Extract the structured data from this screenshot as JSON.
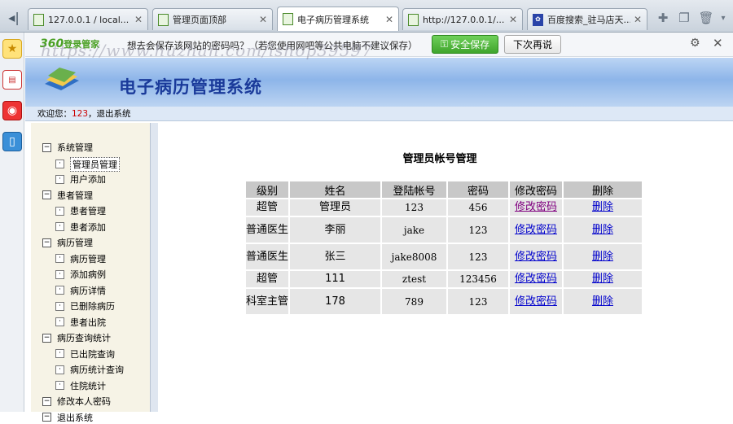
{
  "browser": {
    "tabs": [
      {
        "title": "127.0.0.1 / local...",
        "active": false
      },
      {
        "title": "管理页面顶部",
        "active": false
      },
      {
        "title": "电子病历管理系统",
        "active": true
      },
      {
        "title": "http://127.0.0.1/...",
        "active": false
      },
      {
        "title": "百度搜索_驻马店天...",
        "active": false
      }
    ],
    "tab_close_glyph": "✕",
    "toolbar_icons": [
      "plus-icon",
      "restore-icon",
      "trash-icon",
      "dropdown-icon"
    ]
  },
  "password_bar": {
    "brand": "360",
    "brand_sub": "登录管家",
    "message": "想去会保存该网站的密码吗？（若您使用网吧等公共电脑不建议保存）",
    "save_label": "安全保存",
    "later_label": "下次再说"
  },
  "watermark": "https://www.huzhan.com/ishop39597",
  "app": {
    "title": "电子病历管理系统",
    "welcome_prefix": "欢迎您：",
    "user": "123",
    "logout_link": "，退出系统"
  },
  "tree": {
    "groups": [
      {
        "label": "系统管理",
        "children": [
          "管理员管理",
          "用户添加"
        ]
      },
      {
        "label": "患者管理",
        "children": [
          "患者管理",
          "患者添加"
        ]
      },
      {
        "label": "病历管理",
        "children": [
          "病历管理",
          "添加病例",
          "病历详情",
          "已删除病历",
          "患者出院"
        ]
      },
      {
        "label": "病历查询统计",
        "children": [
          "已出院查询",
          "病历统计查询",
          "住院统计"
        ]
      },
      {
        "label": "修改本人密码",
        "children": []
      },
      {
        "label": "退出系统",
        "children": []
      }
    ]
  },
  "content": {
    "title": "管理员帐号管理",
    "headers": [
      "级别",
      "姓名",
      "登陆帐号",
      "密码",
      "修改密码",
      "删除"
    ],
    "rows": [
      {
        "level": "超管",
        "name": "管理员",
        "account": "123",
        "password": "456",
        "edit": "修改密码",
        "delete": "删除"
      },
      {
        "level": "普通医生",
        "name": "李丽",
        "account": "jake",
        "password": "123",
        "edit": "修改密码",
        "delete": "删除"
      },
      {
        "level": "普通医生",
        "name": "张三",
        "account": "jake8008",
        "password": "123",
        "edit": "修改密码",
        "delete": "删除"
      },
      {
        "level": "超管",
        "name": "111",
        "account": "ztest",
        "password": "123456",
        "edit": "修改密码",
        "delete": "删除"
      },
      {
        "level": "科室主管",
        "name": "178",
        "account": "789",
        "password": "123",
        "edit": "修改密码",
        "delete": "删除"
      }
    ]
  }
}
